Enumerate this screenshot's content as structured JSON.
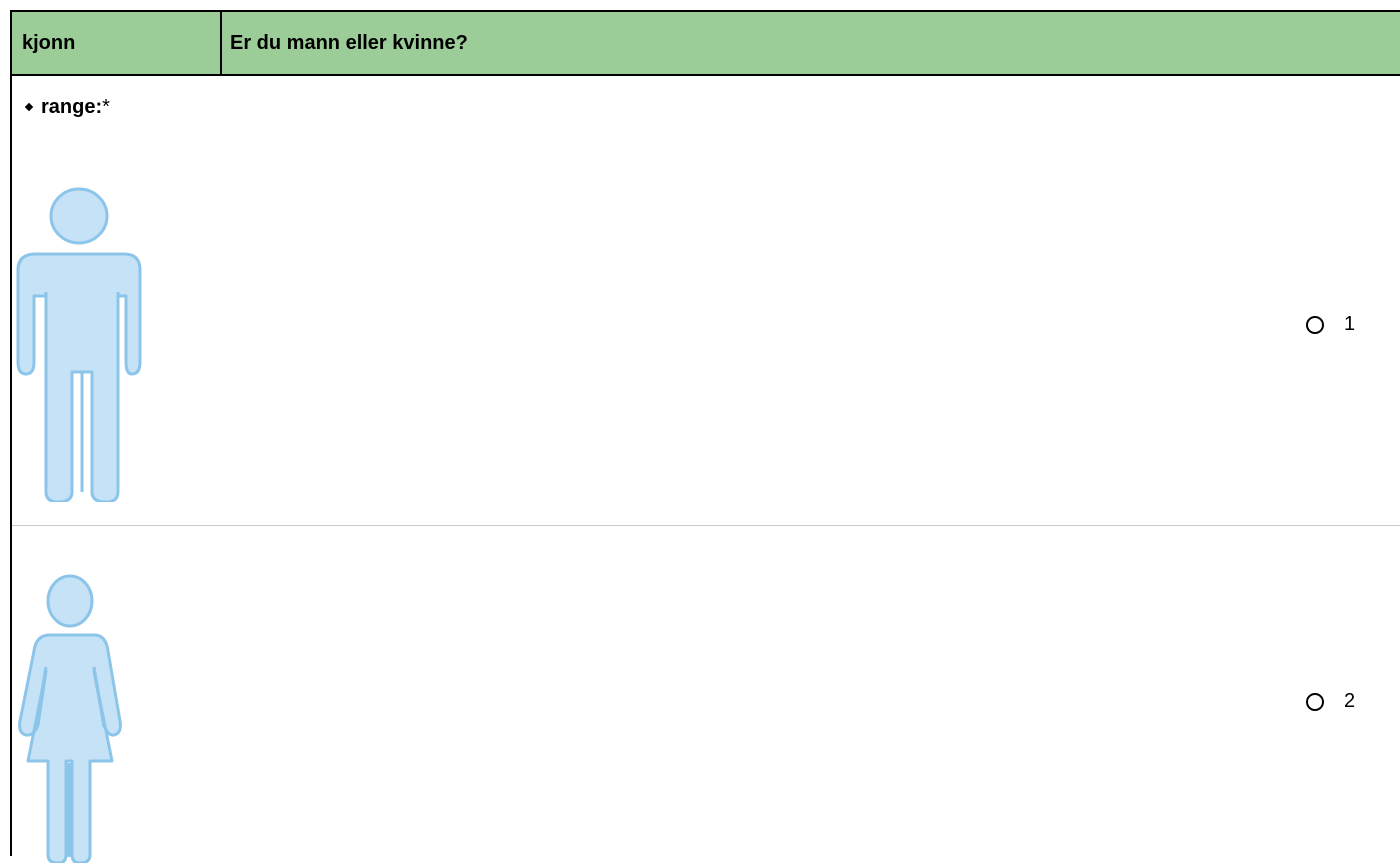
{
  "header": {
    "variable_name": "kjonn",
    "question": "Er du mann eller kvinne?",
    "background_color": "#9ccc97"
  },
  "range": {
    "label": "range:",
    "required_marker": "*"
  },
  "options": [
    {
      "icon": "male-figure-icon",
      "value": "1",
      "selected": false
    },
    {
      "icon": "female-figure-icon",
      "value": "2",
      "selected": false
    }
  ],
  "colors": {
    "figure_fill": "#c6e2f7",
    "figure_stroke": "#8cc5ea"
  }
}
